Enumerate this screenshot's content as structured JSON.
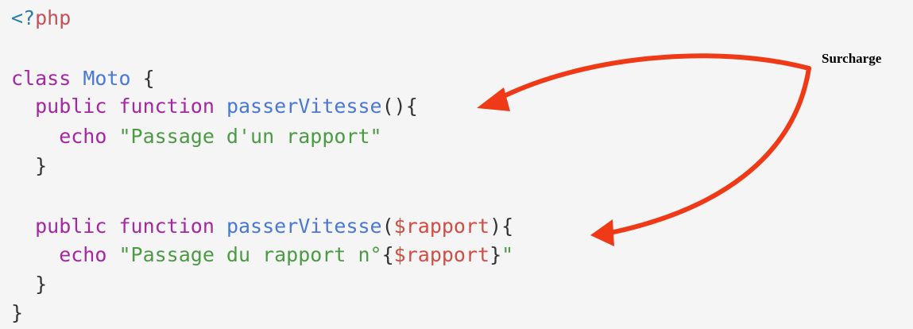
{
  "code_lines": [
    [
      {
        "t": "<?",
        "c": "tag"
      },
      {
        "t": "php",
        "c": "phpkw"
      }
    ],
    [],
    [
      {
        "t": "class ",
        "c": "kw"
      },
      {
        "t": "Moto",
        "c": "cls"
      },
      {
        "t": " {",
        "c": "punc"
      }
    ],
    [
      {
        "t": "  public ",
        "c": "kw"
      },
      {
        "t": "function ",
        "c": "kw"
      },
      {
        "t": "passerVitesse",
        "c": "fn"
      },
      {
        "t": "(){",
        "c": "punc"
      }
    ],
    [
      {
        "t": "    echo ",
        "c": "kw"
      },
      {
        "t": "\"Passage d'un rapport\"",
        "c": "str"
      }
    ],
    [
      {
        "t": "  }",
        "c": "punc"
      }
    ],
    [],
    [
      {
        "t": "  public ",
        "c": "kw"
      },
      {
        "t": "function ",
        "c": "kw"
      },
      {
        "t": "passerVitesse",
        "c": "fn"
      },
      {
        "t": "(",
        "c": "punc"
      },
      {
        "t": "$rapport",
        "c": "var"
      },
      {
        "t": "){",
        "c": "punc"
      }
    ],
    [
      {
        "t": "    echo ",
        "c": "kw"
      },
      {
        "t": "\"Passage du rapport n°",
        "c": "str"
      },
      {
        "t": "{",
        "c": "punc"
      },
      {
        "t": "$rapport",
        "c": "var"
      },
      {
        "t": "}",
        "c": "punc"
      },
      {
        "t": "\"",
        "c": "str"
      }
    ],
    [
      {
        "t": "  }",
        "c": "punc"
      }
    ],
    [
      {
        "t": "}",
        "c": "punc"
      }
    ]
  ],
  "annotation": {
    "label": "Surcharge"
  },
  "colors": {
    "background": "#f5f5f6",
    "arrow": "#f03a17",
    "keyword": "#a626a4",
    "function_name": "#4a78d6",
    "string": "#4c9a43",
    "variable": "#d24d42",
    "php_tag": "#2a7ba8"
  }
}
